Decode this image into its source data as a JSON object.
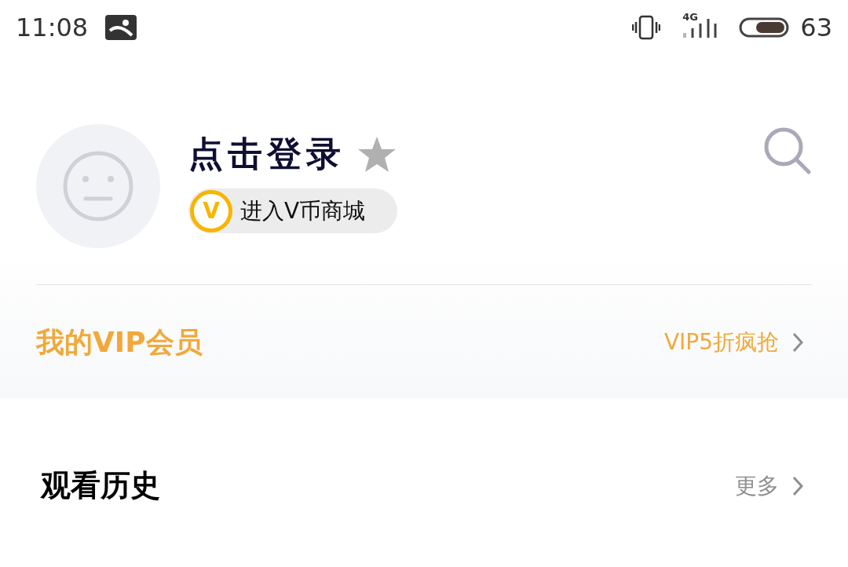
{
  "status_bar": {
    "time": "11:08",
    "network": "4G",
    "battery": "63"
  },
  "profile": {
    "title": "点击登录",
    "coin_badge": "V",
    "coin_link": "进入V币商城"
  },
  "vip": {
    "label": "我的VIP会员",
    "promo": "VIP5折疯抢"
  },
  "history": {
    "title": "观看历史",
    "more": "更多"
  }
}
